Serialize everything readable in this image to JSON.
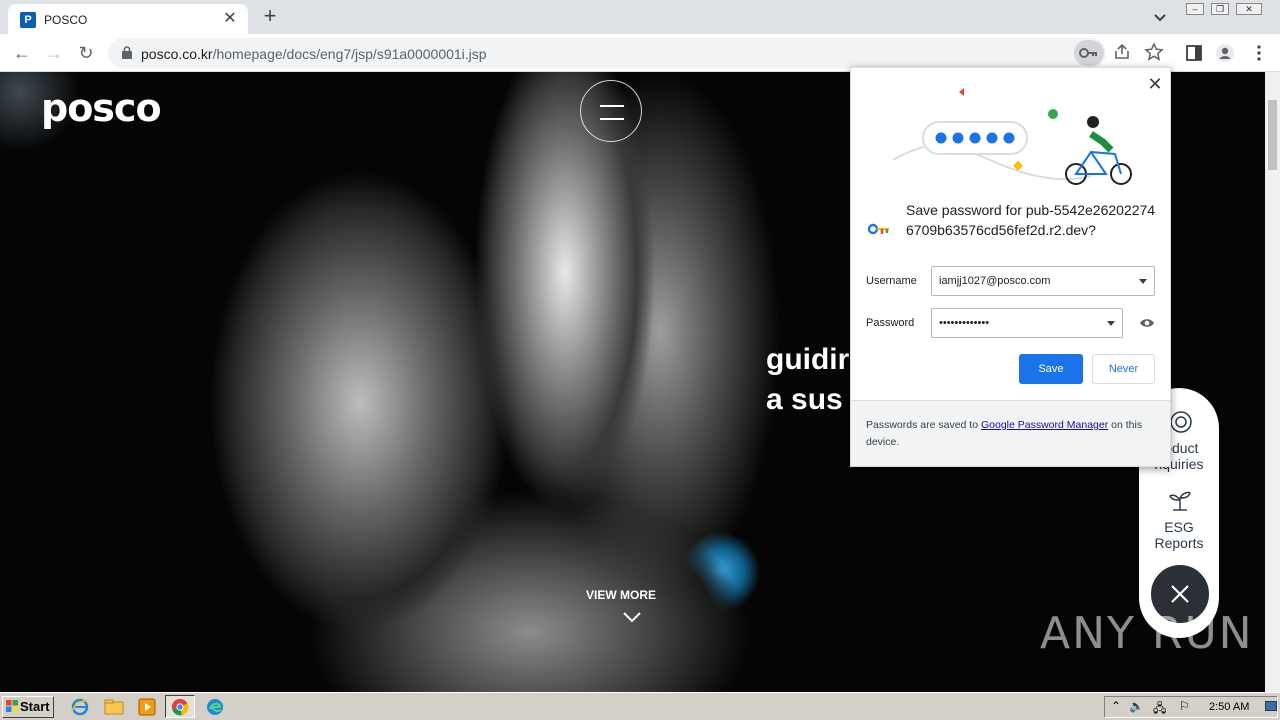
{
  "browser": {
    "tab_title": "POSCO",
    "tab_favicon_letter": "P",
    "url_domain": "posco.co.kr",
    "url_path": "/homepage/docs/eng7/jsp/s91a0000001i.jsp"
  },
  "page": {
    "logo": "posco",
    "hero_line1": "guidir",
    "hero_line2": "a sus",
    "view_more": "VIEW MORE",
    "quick_links": [
      {
        "label": "roduct\nnquiries",
        "icon": "tube-icon"
      },
      {
        "label": "ESG\nReports",
        "icon": "sprout-icon"
      }
    ],
    "watermark": "ANY RUN"
  },
  "password_bubble": {
    "title": "Save password for pub-5542e262022746709b63576cd56fef2d.r2.dev?",
    "username_label": "Username",
    "username_value": "iamjj1027@posco.com",
    "password_label": "Password",
    "password_value": "•••••••••••••",
    "save_label": "Save",
    "never_label": "Never",
    "footer_prefix": "Passwords are saved to ",
    "footer_link": "Google Password Manager",
    "footer_suffix": " on this device."
  },
  "taskbar": {
    "start_label": "Start",
    "clock": "2:50 AM"
  }
}
